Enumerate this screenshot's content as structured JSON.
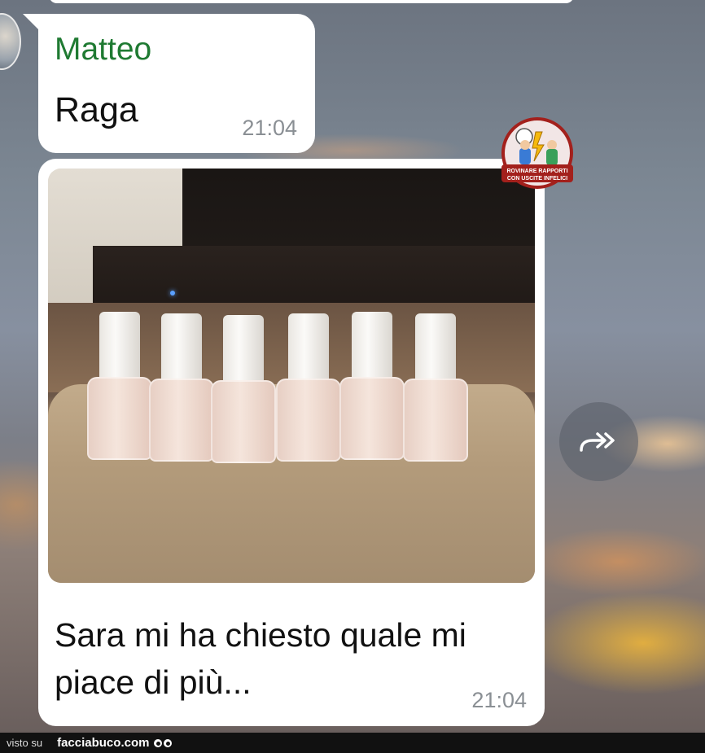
{
  "chat": {
    "messages": [
      {
        "sender": "Matteo",
        "text": "Raga",
        "time": "21:04"
      },
      {
        "image": "nail-polish-bottles-photo",
        "text": "Sara mi ha chiesto quale mi piace di più...",
        "time": "21:04"
      }
    ],
    "forward_icon": "forward-double-arrow-icon"
  },
  "watermark": {
    "logo_text": "ROVINARE RAPPORTI CON USCITE INFELICI"
  },
  "footer": {
    "visto_su": "visto su",
    "site": "facciabuco.com"
  },
  "colors": {
    "sender_name": "#1f7a32",
    "timestamp": "#8a8f94",
    "bubble": "#ffffff"
  }
}
